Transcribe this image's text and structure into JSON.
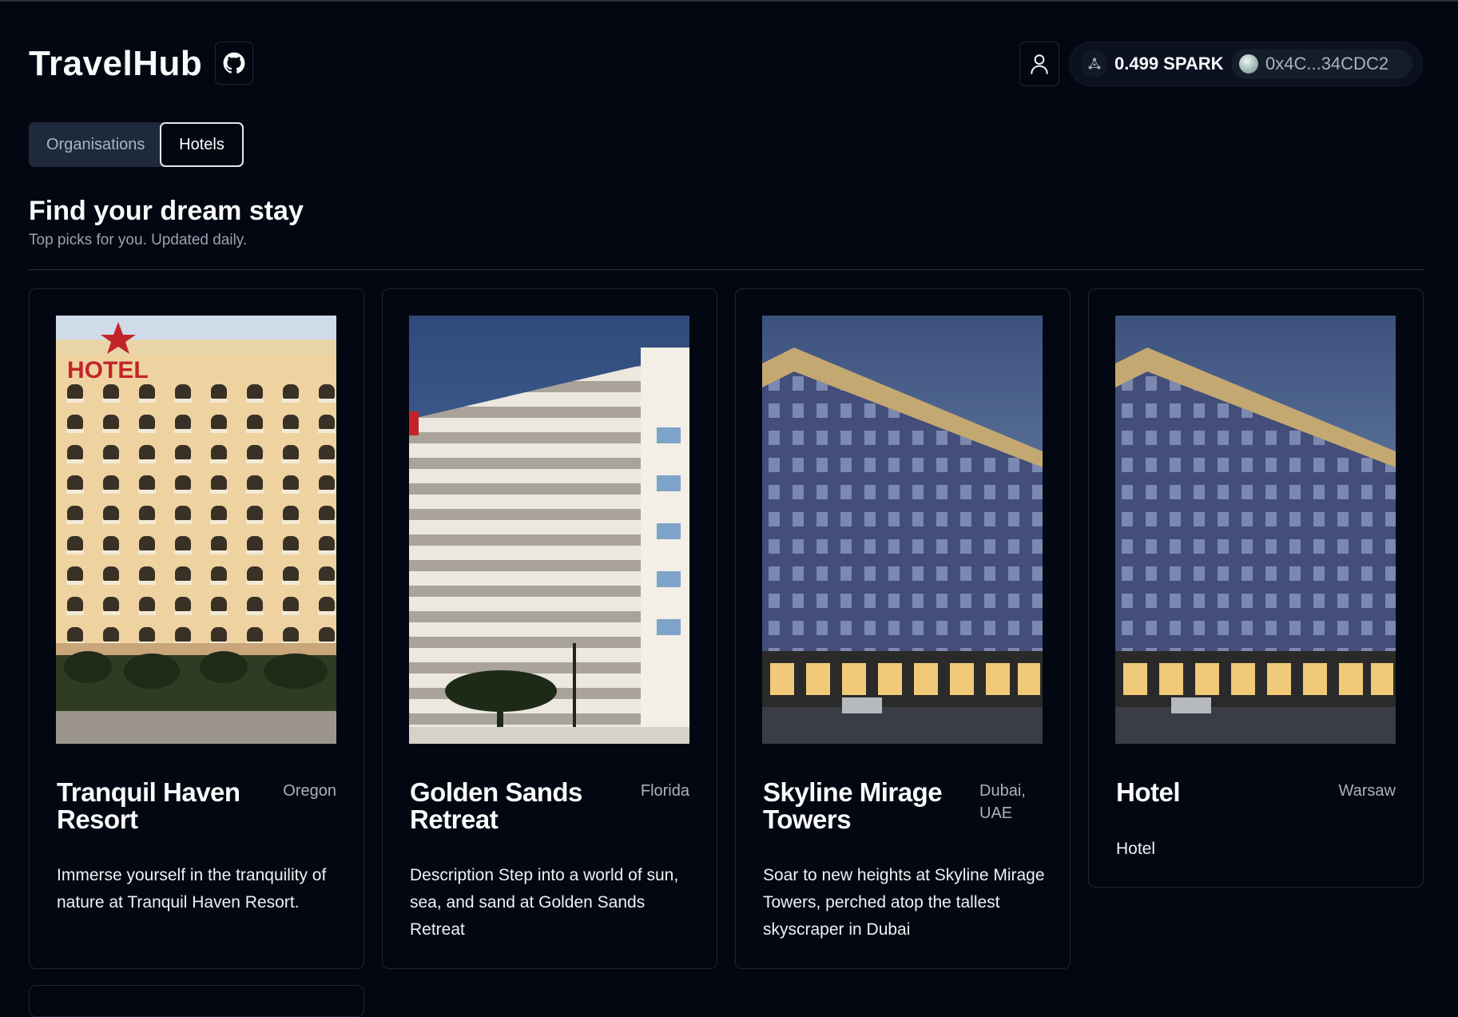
{
  "app": {
    "title": "TravelHub"
  },
  "icons": {
    "github": "github-icon",
    "user": "user-icon",
    "network": "network-icon",
    "wallet_orb": "wallet-avatar"
  },
  "wallet": {
    "balance": "0.499 SPARK",
    "address": "0x4C...34CDC2"
  },
  "tabs": [
    {
      "label": "Organisations",
      "active": false
    },
    {
      "label": "Hotels",
      "active": true
    }
  ],
  "page": {
    "title": "Find your dream stay",
    "subtitle": "Top picks for you. Updated daily."
  },
  "hotels": [
    {
      "name": "Tranquil Haven Resort",
      "location": "Oregon",
      "description": "Immerse yourself in the tranquility of nature at Tranquil Haven Resort.",
      "sign_text": "HOTEL"
    },
    {
      "name": "Golden Sands Retreat",
      "location": "Florida",
      "description": "Description Step into a world of sun, sea, and sand at Golden Sands Retreat"
    },
    {
      "name": "Skyline Mirage Towers",
      "location": "Dubai, UAE",
      "description": "Soar to new heights at Skyline Mirage Towers, perched atop the tallest skyscraper in Dubai"
    },
    {
      "name": "Hotel",
      "location": "Warsaw",
      "description": "Hotel"
    }
  ],
  "colors": {
    "background": "#030711",
    "border": "#1f2633",
    "muted_text": "#9aa3b1",
    "tab_bg": "#1e293b"
  }
}
